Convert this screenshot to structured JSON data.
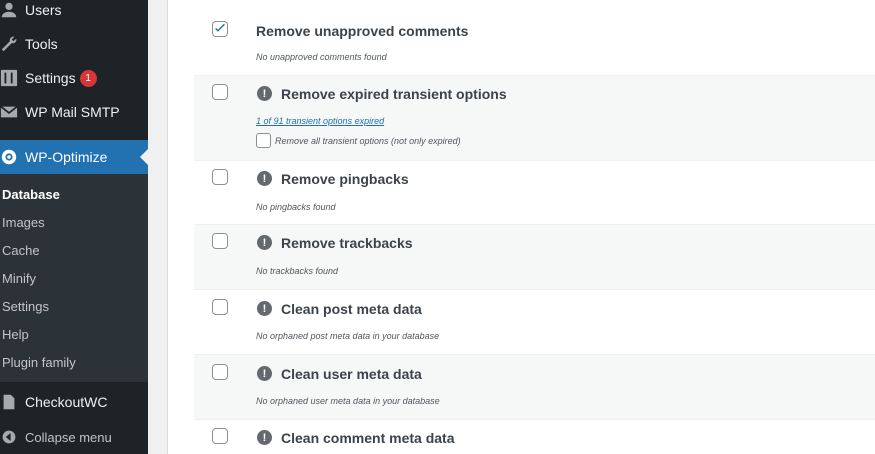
{
  "sidebar": {
    "items": [
      {
        "label": "Users",
        "icon": "users-icon"
      },
      {
        "label": "Tools",
        "icon": "wrench-icon"
      },
      {
        "label": "Settings",
        "icon": "settings-icon",
        "badge": "1"
      },
      {
        "label": "WP Mail SMTP",
        "icon": "mail-icon"
      },
      {
        "label": "WP-Optimize",
        "icon": "wp-optimize-icon",
        "active": true
      }
    ],
    "submenu": [
      "Database",
      "Images",
      "Cache",
      "Minify",
      "Settings",
      "Help",
      "Plugin family"
    ],
    "after": {
      "label": "CheckoutWC",
      "icon": "checkoutwc-icon"
    },
    "collapse_label": "Collapse menu"
  },
  "optimizations": [
    {
      "title": "Remove unapproved comments",
      "checked": true,
      "warning": false,
      "desc": "No unapproved comments found"
    },
    {
      "title": "Remove expired transient options",
      "checked": false,
      "warning": true,
      "link": "1 of 91 transient options expired",
      "option_label": "Remove all transient options (not only expired)"
    },
    {
      "title": "Remove pingbacks",
      "checked": false,
      "warning": true,
      "desc": "No pingbacks found"
    },
    {
      "title": "Remove trackbacks",
      "checked": false,
      "warning": true,
      "desc": "No trackbacks found"
    },
    {
      "title": "Clean post meta data",
      "checked": false,
      "warning": true,
      "desc": "No orphaned post meta data in your database"
    },
    {
      "title": "Clean user meta data",
      "checked": false,
      "warning": true,
      "desc": "No orphaned user meta data in your database"
    },
    {
      "title": "Clean comment meta data",
      "checked": false,
      "warning": true
    }
  ],
  "colors": {
    "sidebar_bg": "#1d2327",
    "active_bg": "#2271b1",
    "badge": "#d63638"
  }
}
